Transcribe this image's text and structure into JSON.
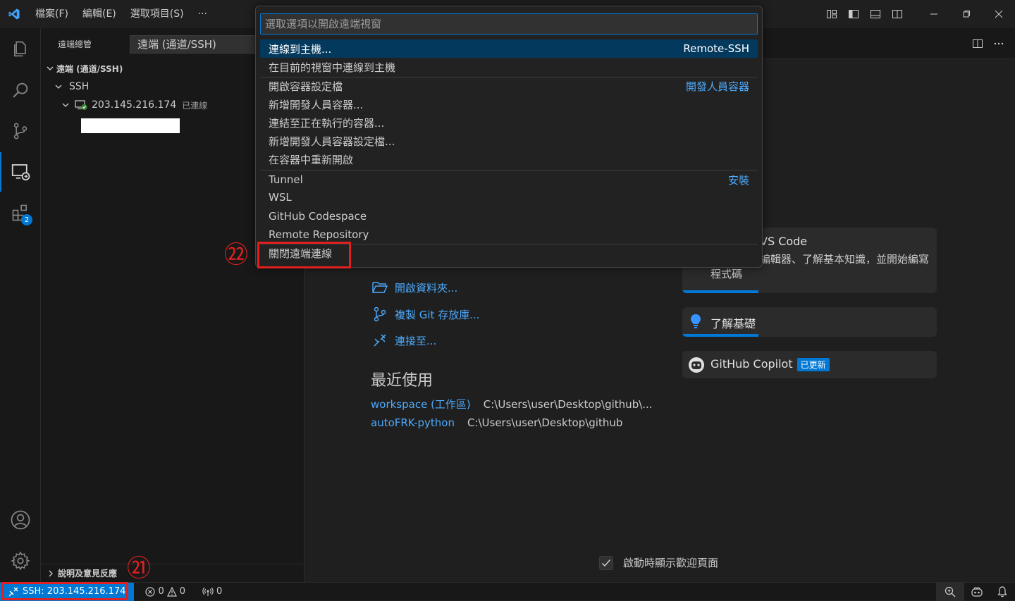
{
  "titlebar": {
    "menus": [
      "檔案(F)",
      "編輯(E)",
      "選取項目(S)",
      "···"
    ]
  },
  "activitybar": {
    "extensions_badge": "2"
  },
  "sidebar": {
    "header": "遠端總管",
    "select_value": "遠端 (通道/SSH)",
    "section_title": "遠端 (通道/SSH)",
    "ssh_label": "SSH",
    "host": "203.145.216.174",
    "host_status": "已連線",
    "footer": "說明及意見反應"
  },
  "quickpick": {
    "placeholder": "選取選項以開啟遠端視窗",
    "groups": [
      {
        "items": [
          {
            "label": "連線到主機...",
            "detail": "Remote-SSH"
          },
          {
            "label": "在目前的視窗中連線到主機",
            "detail": ""
          }
        ]
      },
      {
        "items": [
          {
            "label": "開啟容器設定檔",
            "detail": "開發人員容器"
          },
          {
            "label": "新增開發人員容器...",
            "detail": ""
          },
          {
            "label": "連結至正在執行的容器...",
            "detail": ""
          },
          {
            "label": "新增開發人員容器設定檔...",
            "detail": ""
          },
          {
            "label": "在容器中重新開啟",
            "detail": ""
          }
        ]
      },
      {
        "items": [
          {
            "label": "Tunnel",
            "detail": "安裝"
          },
          {
            "label": "WSL",
            "detail": ""
          },
          {
            "label": "GitHub Codespace",
            "detail": ""
          },
          {
            "label": "Remote Repository",
            "detail": ""
          }
        ]
      },
      {
        "items": [
          {
            "label": "關閉遠端連線",
            "detail": ""
          }
        ]
      }
    ]
  },
  "annotations": {
    "n21": "㉑",
    "n22": "㉒"
  },
  "welcome": {
    "start_links": [
      "開啟資料夾...",
      "複製 Git 存放庫...",
      "連接至..."
    ],
    "recent_title": "最近使用",
    "recent": [
      {
        "name": "workspace (工作區)",
        "path": "C:\\Users\\user\\Desktop\\github\\..."
      },
      {
        "name": "autoFRK-python",
        "path": "C:\\Users\\user\\Desktop\\github"
      }
    ],
    "walkthroughs": {
      "vscode_title": "VS Code",
      "vscode_desc_1": "編輯器、了解基本知識，並開始編寫",
      "vscode_desc_2": "程式碼",
      "vscode_progress": 0.3,
      "basics_title": "了解基礎",
      "basics_progress": 0.3,
      "copilot_title": "GitHub Copilot",
      "copilot_badge": "已更新"
    },
    "show_on_startup": "啟動時顯示歡迎頁面"
  },
  "statusbar": {
    "remote": "SSH: 203.145.216.174",
    "errors": "0",
    "warnings": "0",
    "ports": "0"
  },
  "colors": {
    "accent": "#0078d4",
    "link": "#4daafc",
    "annotation_red": "#e02020"
  }
}
